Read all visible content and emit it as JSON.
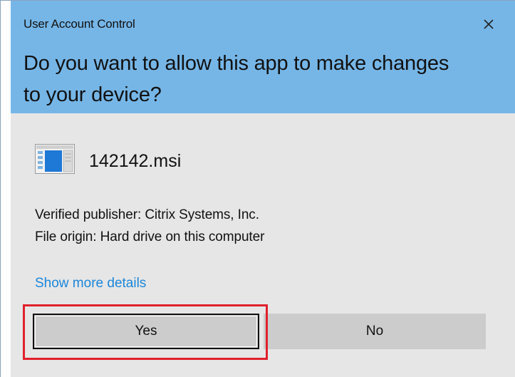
{
  "window": {
    "title": "User Account Control",
    "close_icon": "close-icon",
    "header_color": "#76b6e7"
  },
  "prompt": {
    "heading": "Do you want to allow this app to make changes to your device?"
  },
  "app": {
    "icon": "msi-installer-icon",
    "name": "142142.msi"
  },
  "details": {
    "publisher": "Verified publisher: Citrix Systems, Inc.",
    "origin": "File origin: Hard drive on this computer",
    "more_link": "Show more details",
    "link_color": "#1a86d9"
  },
  "buttons": {
    "yes_label": "Yes",
    "no_label": "No"
  },
  "annotation": {
    "highlight_color": "#e0202c"
  }
}
